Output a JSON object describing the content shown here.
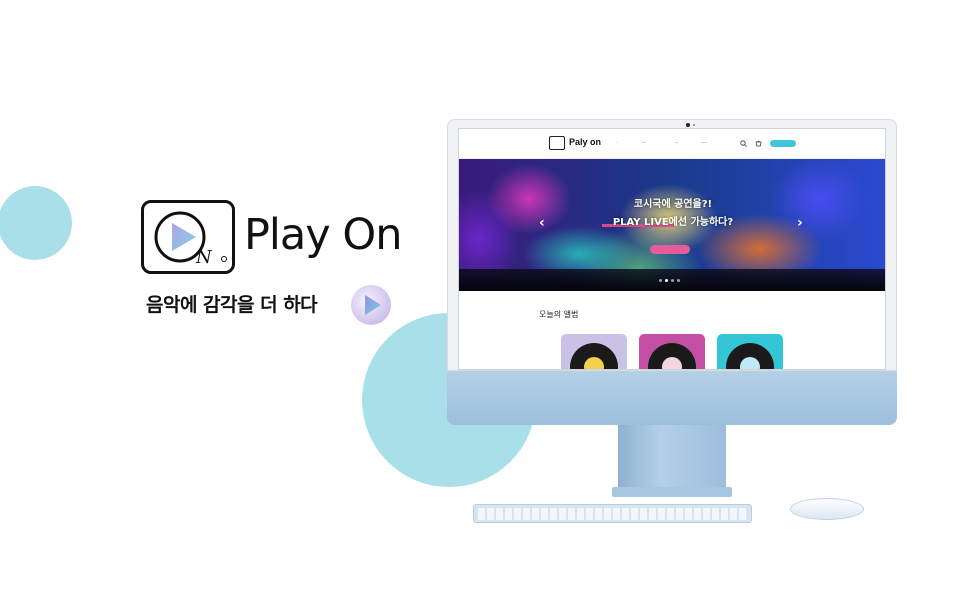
{
  "brand": {
    "name": "Play On",
    "tagline": "음악에 감각을 더 하다",
    "logo_icon": "play-on-logo-icon",
    "badge_icon": "play-badge-icon"
  },
  "colors": {
    "accent": "#a9dfe8",
    "imac_body": "#a9c8e3",
    "login_button": "#3fc6d9",
    "hero_button": "#e65c9a"
  },
  "screen": {
    "nav": {
      "brand": "Paly on",
      "items": [
        "<span style='display:none'></span>",
        "",
        "",
        ""
      ],
      "search_icon": "search-icon",
      "cart_icon": "cart-icon",
      "login_label": ""
    },
    "hero": {
      "line1": "코시국에 공연을?!",
      "line2": "PLAY LIVE에선 가능하다?",
      "button_label": "",
      "prev_icon": "chevron-left-icon",
      "next_icon": "chevron-right-icon"
    },
    "section_title": "오늘의 앨범",
    "albums": [
      {
        "bg": "#c9c2e6",
        "label": "#f2d04a"
      },
      {
        "bg": "#c64fa6",
        "label": "#f4d6e2"
      },
      {
        "bg": "#34c5d6",
        "label": "#bfe8f6"
      }
    ]
  }
}
